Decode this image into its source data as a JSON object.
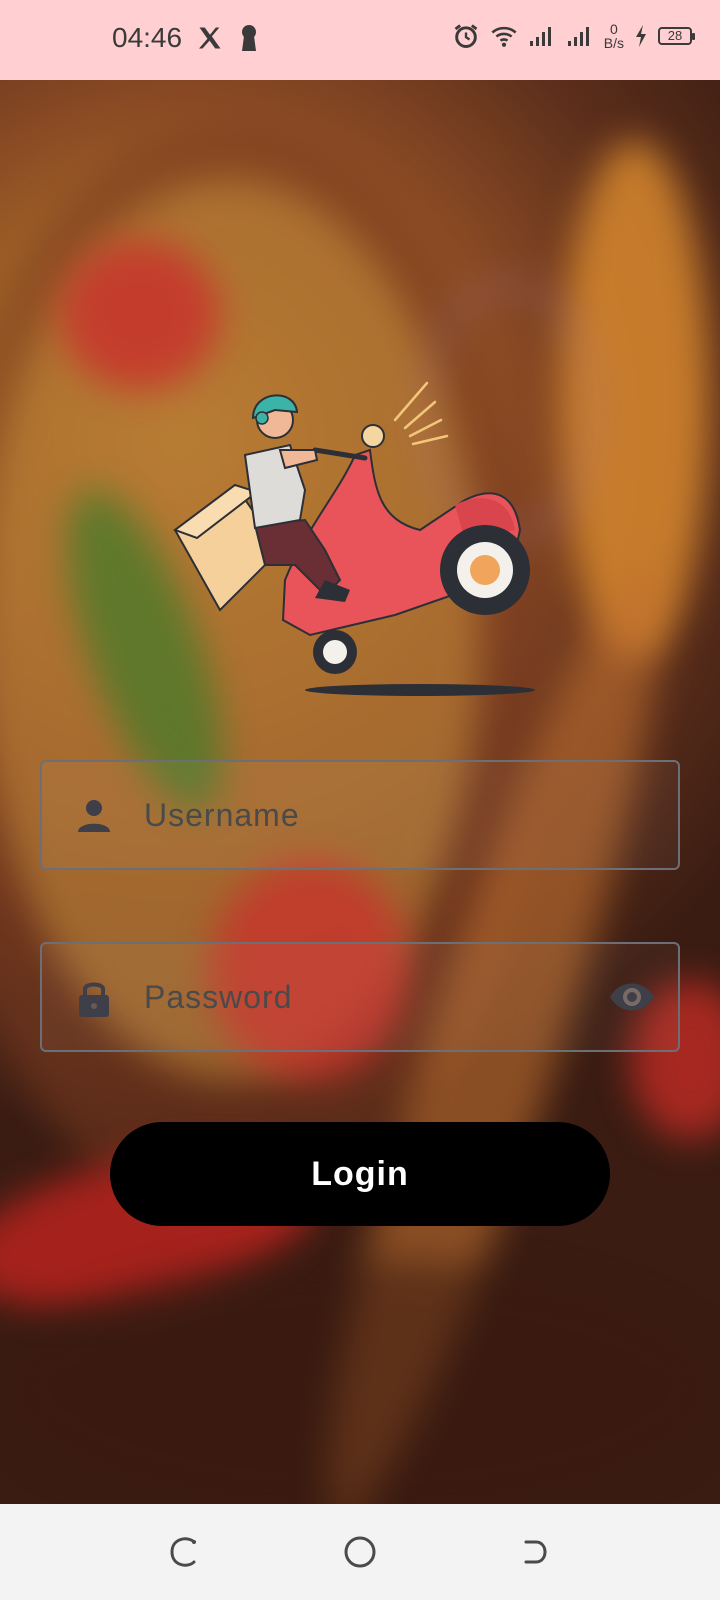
{
  "status_bar": {
    "time": "04:46",
    "net_speed_value": "0",
    "net_speed_unit": "B/s",
    "battery": "28"
  },
  "illustration": {
    "icon": "scooter-delivery-icon"
  },
  "login_form": {
    "username_placeholder": "Username",
    "password_placeholder": "Password",
    "login_label": "Login"
  },
  "colors": {
    "status_bar_bg": "#ffcfd1",
    "scooter_red": "#e8545a",
    "button_bg": "#000000"
  }
}
